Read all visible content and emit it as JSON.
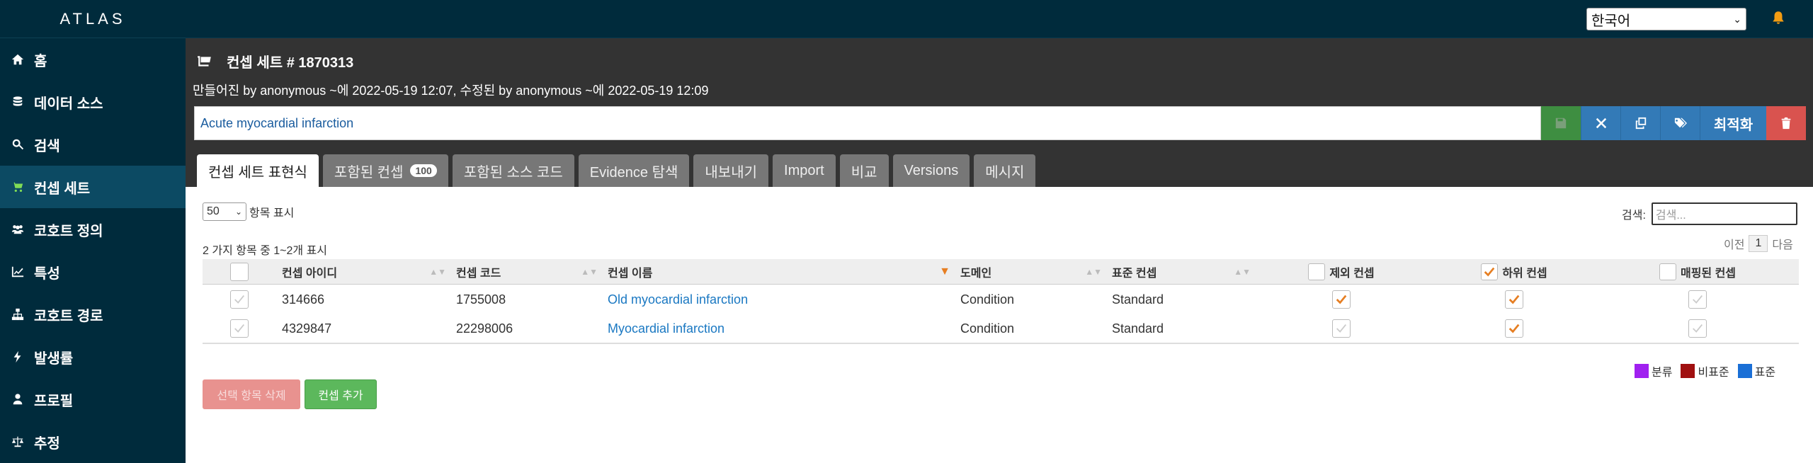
{
  "app": {
    "brand": "ATLAS"
  },
  "sidebar": {
    "items": [
      {
        "label": "홈",
        "icon": "home-icon"
      },
      {
        "label": "데이터 소스",
        "icon": "database-icon"
      },
      {
        "label": "검색",
        "icon": "search-icon"
      },
      {
        "label": "컨셉 세트",
        "icon": "cart-icon",
        "active": true
      },
      {
        "label": "코호트 정의",
        "icon": "users-icon"
      },
      {
        "label": "특성",
        "icon": "line-chart-icon"
      },
      {
        "label": "코호트 경로",
        "icon": "sitemap-icon"
      },
      {
        "label": "발생률",
        "icon": "bolt-icon"
      },
      {
        "label": "프로필",
        "icon": "user-icon"
      },
      {
        "label": "추정",
        "icon": "balance-scale-icon"
      }
    ]
  },
  "topbar": {
    "language": "한국어"
  },
  "header": {
    "title": "컨셉 세트 # 1870313",
    "meta": "만들어진 by anonymous ~에 2022-05-19 12:07, 수정된 by anonymous ~에 2022-05-19 12:09",
    "name_value": "Acute myocardial infarction",
    "optimize_label": "최적화"
  },
  "tabs": [
    {
      "label": "컨셉 세트 표현식",
      "active": true
    },
    {
      "label": "포함된 컨셉",
      "badge": "100"
    },
    {
      "label": "포함된 소스 코드"
    },
    {
      "label": "Evidence 탐색"
    },
    {
      "label": "내보내기"
    },
    {
      "label": "Import"
    },
    {
      "label": "비교"
    },
    {
      "label": "Versions"
    },
    {
      "label": "메시지"
    }
  ],
  "table_controls": {
    "page_length": "50",
    "page_length_suffix": "항목 표시",
    "search_label": "검색:",
    "search_placeholder": "검색...",
    "info": "2 가지 항목 중 1~2개 표시",
    "prev": "이전",
    "page": "1",
    "next": "다음"
  },
  "table": {
    "columns": [
      "컨셉 아이디",
      "컨셉 코드",
      "컨셉 이름",
      "도메인",
      "표준 컨셉",
      "제외 컨셉",
      "하위 컨셉",
      "매핑된 컨셉"
    ],
    "rows": [
      {
        "id": "314666",
        "code": "1755008",
        "name": "Old myocardial infarction",
        "domain": "Condition",
        "standard": "Standard",
        "excluded": true,
        "descendants": true,
        "mapped": false
      },
      {
        "id": "4329847",
        "code": "22298006",
        "name": "Myocardial infarction",
        "domain": "Condition",
        "standard": "Standard",
        "excluded": false,
        "descendants": true,
        "mapped": false
      }
    ]
  },
  "legend": [
    {
      "label": "분류",
      "color": "#a020f0"
    },
    {
      "label": "비표준",
      "color": "#a01010"
    },
    {
      "label": "표준",
      "color": "#1a6fd6"
    }
  ],
  "buttons": {
    "delete_selected": "선택 항목 삭제",
    "add_concept": "컨셉 추가"
  },
  "colors": {
    "accent_orange": "#e67e22",
    "nav_bg": "#002b3c",
    "header_bg": "#333333"
  }
}
